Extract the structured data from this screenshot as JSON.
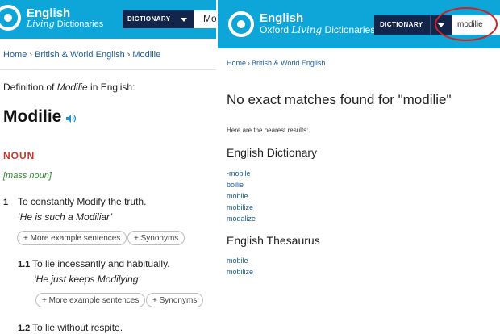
{
  "left": {
    "brand": "English",
    "brand_sub_italic": "Living",
    "brand_sub_rest": " Dictionaries",
    "dictionary_label": "DICTIONARY",
    "search_value": "Mo",
    "breadcrumb": [
      "Home",
      "British & World English",
      "Modilie"
    ],
    "definition_prefix": "Definition of ",
    "definition_word": "Modilie",
    "definition_suffix": " in English:",
    "headword": "Modilie",
    "part_of_speech": "NOUN",
    "grammar_note": "[mass noun]",
    "senses": [
      {
        "number": "1",
        "text": "To constantly Modify the truth.",
        "example": "‘He is such a Modiliar’",
        "more_examples": "+ More example sentences",
        "synonyms": "+ Synonyms"
      },
      {
        "number": "1.1",
        "text": "To lie incessantly and habitually.",
        "example": "‘He just keeps Modilying’",
        "more_examples": "+ More example sentences",
        "synonyms": "+ Synonyms"
      },
      {
        "number": "1.2",
        "text": "To lie without respite."
      }
    ]
  },
  "right": {
    "brand": "English",
    "brand_sub_pre": "Oxford ",
    "brand_sub_italic": "Living",
    "brand_sub_rest": " Dictionaries",
    "dictionary_label": "DICTIONARY",
    "search_value": "modilie",
    "breadcrumb": [
      "Home",
      "British & World English"
    ],
    "no_match_heading": "No exact matches found for \"modilie\"",
    "nearest_label": "Here are the nearest results:",
    "dictionary_section": {
      "title": "English Dictionary",
      "results": [
        "-mobile",
        "boilie",
        "mobile",
        "mobilize",
        "modalize"
      ]
    },
    "thesaurus_section": {
      "title": "English Thesaurus",
      "results": [
        "mobile",
        "mobilize"
      ]
    }
  },
  "colors": {
    "header_blue": "#0ea5d8",
    "navy_button": "#13254a",
    "link_blue": "#1c5c9a",
    "noun_red": "#c0392b",
    "grammar_green": "#2e8b2e",
    "highlight_circle": "#d0201f"
  },
  "icons": {
    "logo": "ring-logo-icon",
    "speaker": "speaker-icon",
    "dropdown": "caret-down-icon"
  }
}
